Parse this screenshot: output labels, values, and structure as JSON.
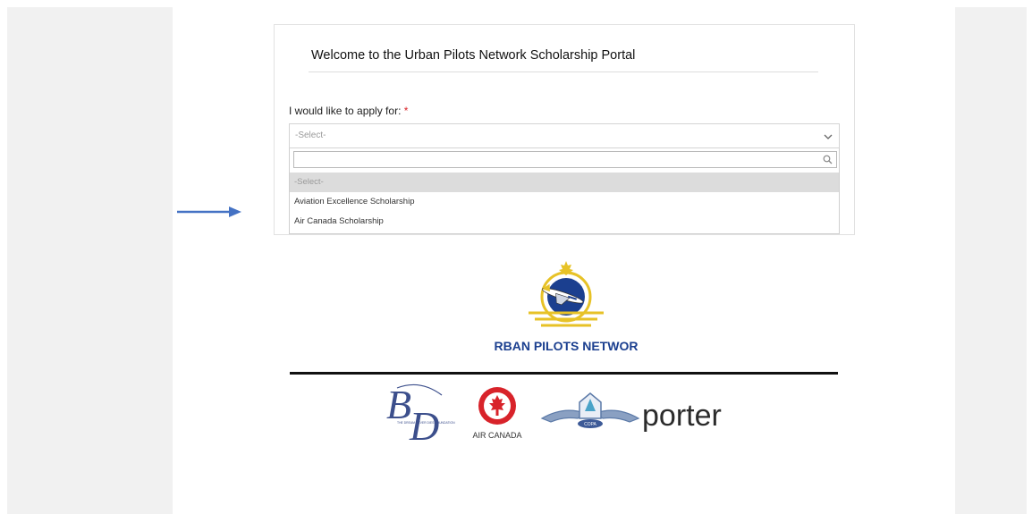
{
  "portal": {
    "title": "Welcome to the Urban Pilots Network Scholarship Portal"
  },
  "form": {
    "label": "I would like to apply for:",
    "required_mark": "*",
    "select": {
      "selected": "-Select-",
      "search_placeholder": "",
      "options": [
        "-Select-",
        "Aviation Excellence Scholarship",
        "Air Canada Scholarship"
      ]
    }
  },
  "logos": {
    "main": "URBAN PILOTS NETWORK",
    "bd_tagline": "THE DREAM NEVER DIES FOUNDATION",
    "air_canada": "AIR CANADA",
    "copa": "COPA",
    "porter": "porter"
  },
  "colors": {
    "arrow": "#4472c4",
    "required": "#d9262b",
    "upn_navy": "#1b3f8f",
    "upn_gold": "#e7c227",
    "air_canada_red": "#d8232a",
    "copa_blue": "#5c7aa8",
    "bd_blue": "#3c4f8c"
  }
}
